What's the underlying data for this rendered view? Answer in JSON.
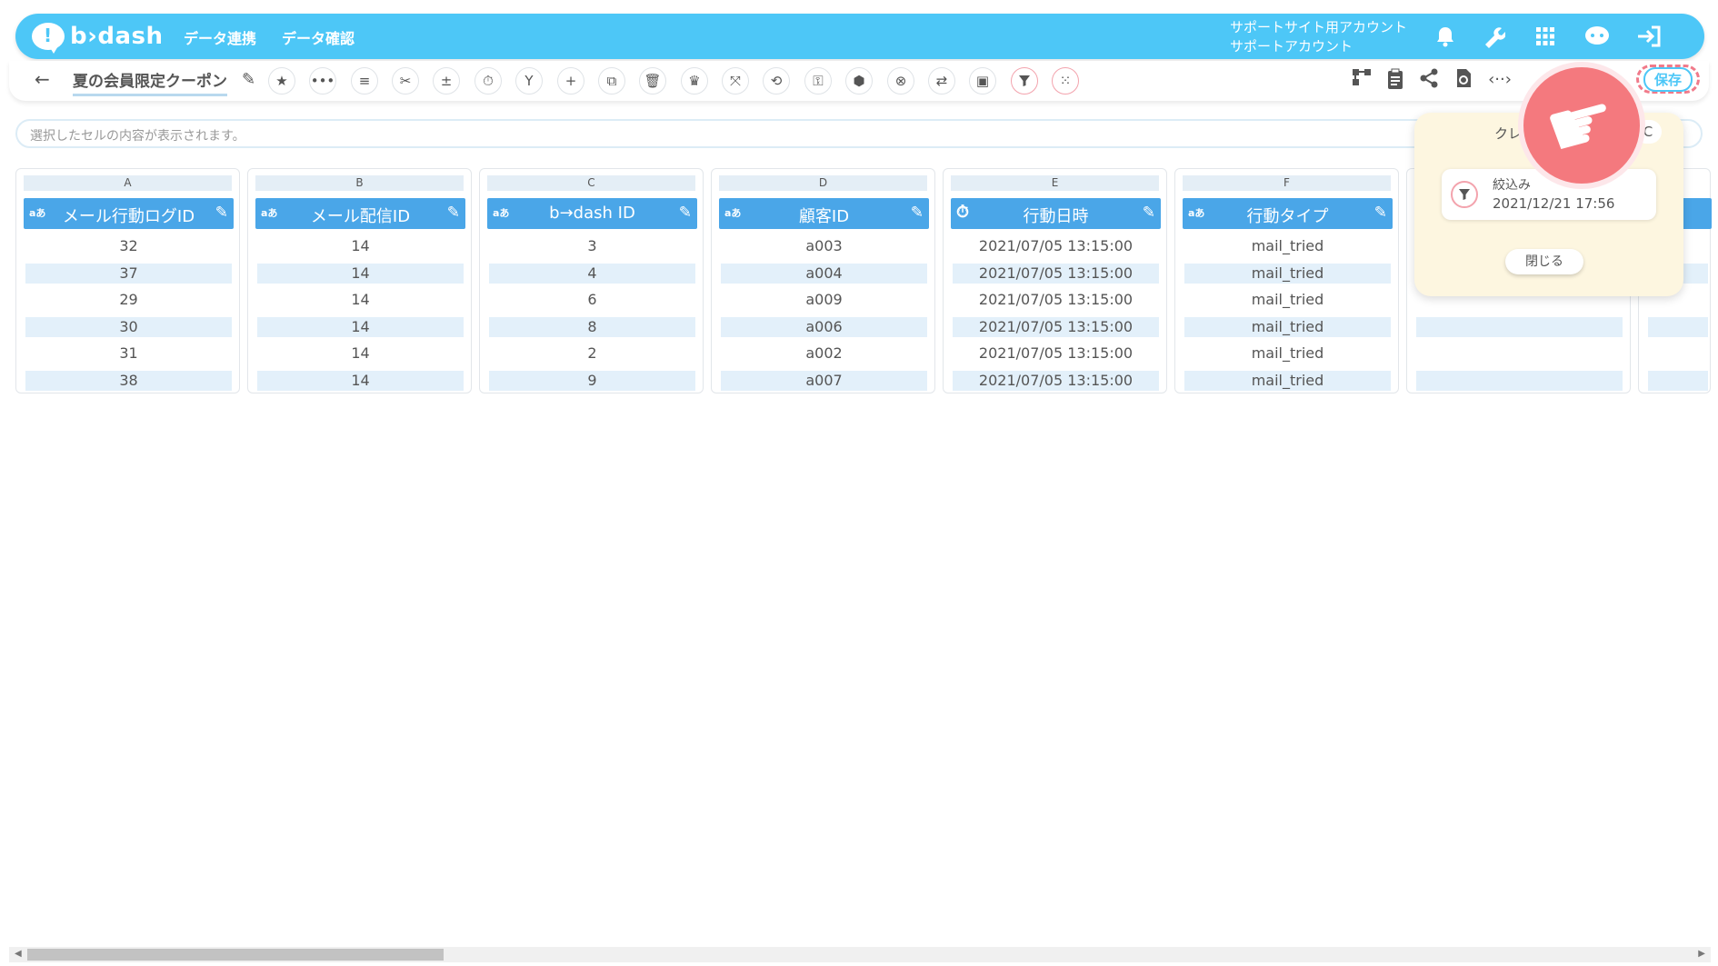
{
  "header": {
    "logo_text": "b›dash",
    "nav": [
      "データ連携",
      "データ確認"
    ],
    "account_line1": "サポートサイト用アカウント",
    "account_line2": "サポートアカウント"
  },
  "toolbar": {
    "back": "←",
    "title": "夏の会員限定クーポン",
    "save_label": "保存"
  },
  "cellbar": {
    "placeholder": "選択したセルの内容が表示されます。"
  },
  "columns": [
    {
      "letter": "A",
      "type": "aあ",
      "label": "メール行動ログID",
      "values": [
        "32",
        "37",
        "29",
        "30",
        "31",
        "38"
      ]
    },
    {
      "letter": "B",
      "type": "aあ",
      "label": "メール配信ID",
      "values": [
        "14",
        "14",
        "14",
        "14",
        "14",
        "14"
      ]
    },
    {
      "letter": "C",
      "type": "aあ",
      "label": "b→dash ID",
      "values": [
        "3",
        "4",
        "6",
        "8",
        "2",
        "9"
      ]
    },
    {
      "letter": "D",
      "type": "aあ",
      "label": "顧客ID",
      "values": [
        "a003",
        "a004",
        "a009",
        "a006",
        "a002",
        "a007"
      ]
    },
    {
      "letter": "E",
      "type": "⏱",
      "label": "行動日時",
      "values": [
        "2021/07/05 13:15:00",
        "2021/07/05 13:15:00",
        "2021/07/05 13:15:00",
        "2021/07/05 13:15:00",
        "2021/07/05 13:15:00",
        "2021/07/05 13:15:00"
      ]
    },
    {
      "letter": "F",
      "type": "aあ",
      "label": "行動タイプ",
      "values": [
        "mail_tried",
        "mail_tried",
        "mail_tried",
        "mail_tried",
        "mail_tried",
        "mail_tried"
      ]
    }
  ],
  "popup": {
    "title": "クレ",
    "close_x": "C",
    "item_title": "絞込み",
    "item_date": "2021/12/21 17:56",
    "close_label": "閉じる"
  }
}
